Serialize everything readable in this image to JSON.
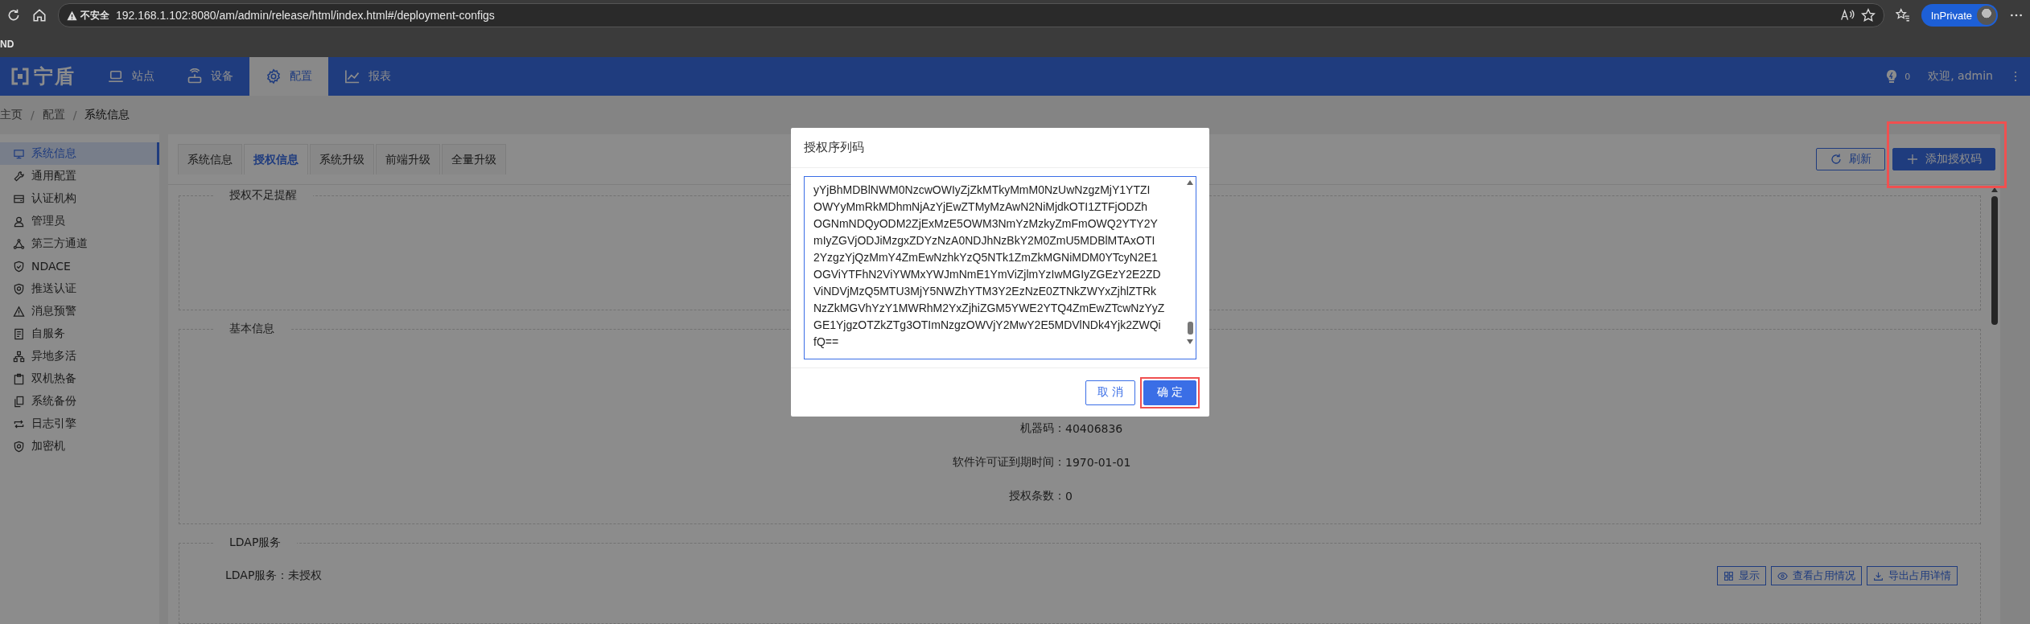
{
  "browser": {
    "security_label": "不安全",
    "address": "192.168.1.102:8080/am/admin/release/html/index.html#/deployment-configs",
    "profile_label": "InPrivate",
    "bookmark": "ND"
  },
  "nav": {
    "logo": "宁盾",
    "items": [
      {
        "label": "站点",
        "kind": "laptop",
        "selected": false
      },
      {
        "label": "设备",
        "kind": "router",
        "selected": false
      },
      {
        "label": "配置",
        "kind": "gear",
        "selected": true
      },
      {
        "label": "报表",
        "kind": "chart",
        "selected": false
      }
    ],
    "notification_count": "0",
    "welcome": "欢迎, admin"
  },
  "breadcrumb": {
    "items": [
      "主页",
      "配置",
      "系统信息"
    ],
    "separator": "/"
  },
  "sidebar": {
    "items": [
      {
        "label": "系统信息",
        "kind": "monitor",
        "selected": true
      },
      {
        "label": "通用配置",
        "kind": "wrench",
        "selected": false
      },
      {
        "label": "认证机构",
        "kind": "card",
        "selected": false
      },
      {
        "label": "管理员",
        "kind": "user",
        "selected": false
      },
      {
        "label": "第三方通道",
        "kind": "nodes",
        "selected": false
      },
      {
        "label": "NDACE",
        "kind": "shield-check",
        "selected": false
      },
      {
        "label": "推送认证",
        "kind": "shield-badge",
        "selected": false
      },
      {
        "label": "消息预警",
        "kind": "warning",
        "selected": false
      },
      {
        "label": "自服务",
        "kind": "document",
        "selected": false
      },
      {
        "label": "异地多活",
        "kind": "sitemap",
        "selected": false
      },
      {
        "label": "双机热备",
        "kind": "clipboard",
        "selected": false
      },
      {
        "label": "系统备份",
        "kind": "copy",
        "selected": false
      },
      {
        "label": "日志引擎",
        "kind": "repeat",
        "selected": false
      },
      {
        "label": "加密机",
        "kind": "shield-badge",
        "selected": false
      }
    ]
  },
  "tabs": [
    {
      "label": "系统信息",
      "selected": false
    },
    {
      "label": "授权信息",
      "selected": true
    },
    {
      "label": "系统升级",
      "selected": false
    },
    {
      "label": "前端升级",
      "selected": false
    },
    {
      "label": "全量升级",
      "selected": false
    }
  ],
  "toolbar": {
    "buttons": [
      {
        "label": "刷新",
        "kind": "outline",
        "highlighted": false
      },
      {
        "label": "添加授权码",
        "kind": "primary",
        "highlighted": true
      }
    ]
  },
  "sections": [
    {
      "title": "授权不足提醒"
    },
    {
      "title": "基本信息",
      "fields": [
        {
          "label": "机器码：",
          "value": "40406836"
        },
        {
          "label": "软件许可证到期时间：",
          "value": "1970-01-01"
        },
        {
          "label": "授权条数：",
          "value": "0"
        }
      ]
    },
    {
      "title": "LDAP服务",
      "status": "LDAP服务：未授权",
      "buttons": [
        {
          "label": "显示",
          "kind": "grid"
        },
        {
          "label": "查看占用情况",
          "kind": "eye"
        },
        {
          "label": "导出占用详情",
          "kind": "download"
        }
      ]
    }
  ],
  "dialog": {
    "title": "授权序列码",
    "serial": "yYjBhMDBlNWM0NzcwOWIyZjZkMTkyMmM0NzUwNzgzMjY1YTZI\nOWYyMmRkMDhmNjAzYjEwZTMyMzAwN2NiMjdkOTI1ZTFjODZh\nOGNmNDQyODM2ZjExMzE5OWM3NmYzMzkyZmFmOWQ2YTY2Y\nmIyZGVjODJiMzgxZDYzNzA0NDJhNzBkY2M0ZmU5MDBlMTAxOTI\n2YzgzYjQzMmY4ZmEwNzhkYzQ5NTk1ZmZkMGNiMDM0YTcyN2E1\nOGViYTFhN2ViYWMxYWJmNmE1YmViZjlmYzIwMGIyZGEzY2E2ZD\nViNDVjMzQ5MTU3MjY5NWZhYTM3Y2EzNzE0ZTNkZWYxZjhlZTRk\nNzZkMGVhYzY1MWRhM2YxZjhiZGM5YWE2YTQ4ZmEwZTcwNzYyZ\nGE1YjgzOTZkZTg3OTImNzgzOWVjY2MwY2E5MDVlNDk4Yjk2ZWQi\nfQ==",
    "buttons": [
      {
        "label": "取 消",
        "kind": "cancel",
        "highlighted": false
      },
      {
        "label": "确 定",
        "kind": "confirm",
        "highlighted": true
      }
    ]
  }
}
